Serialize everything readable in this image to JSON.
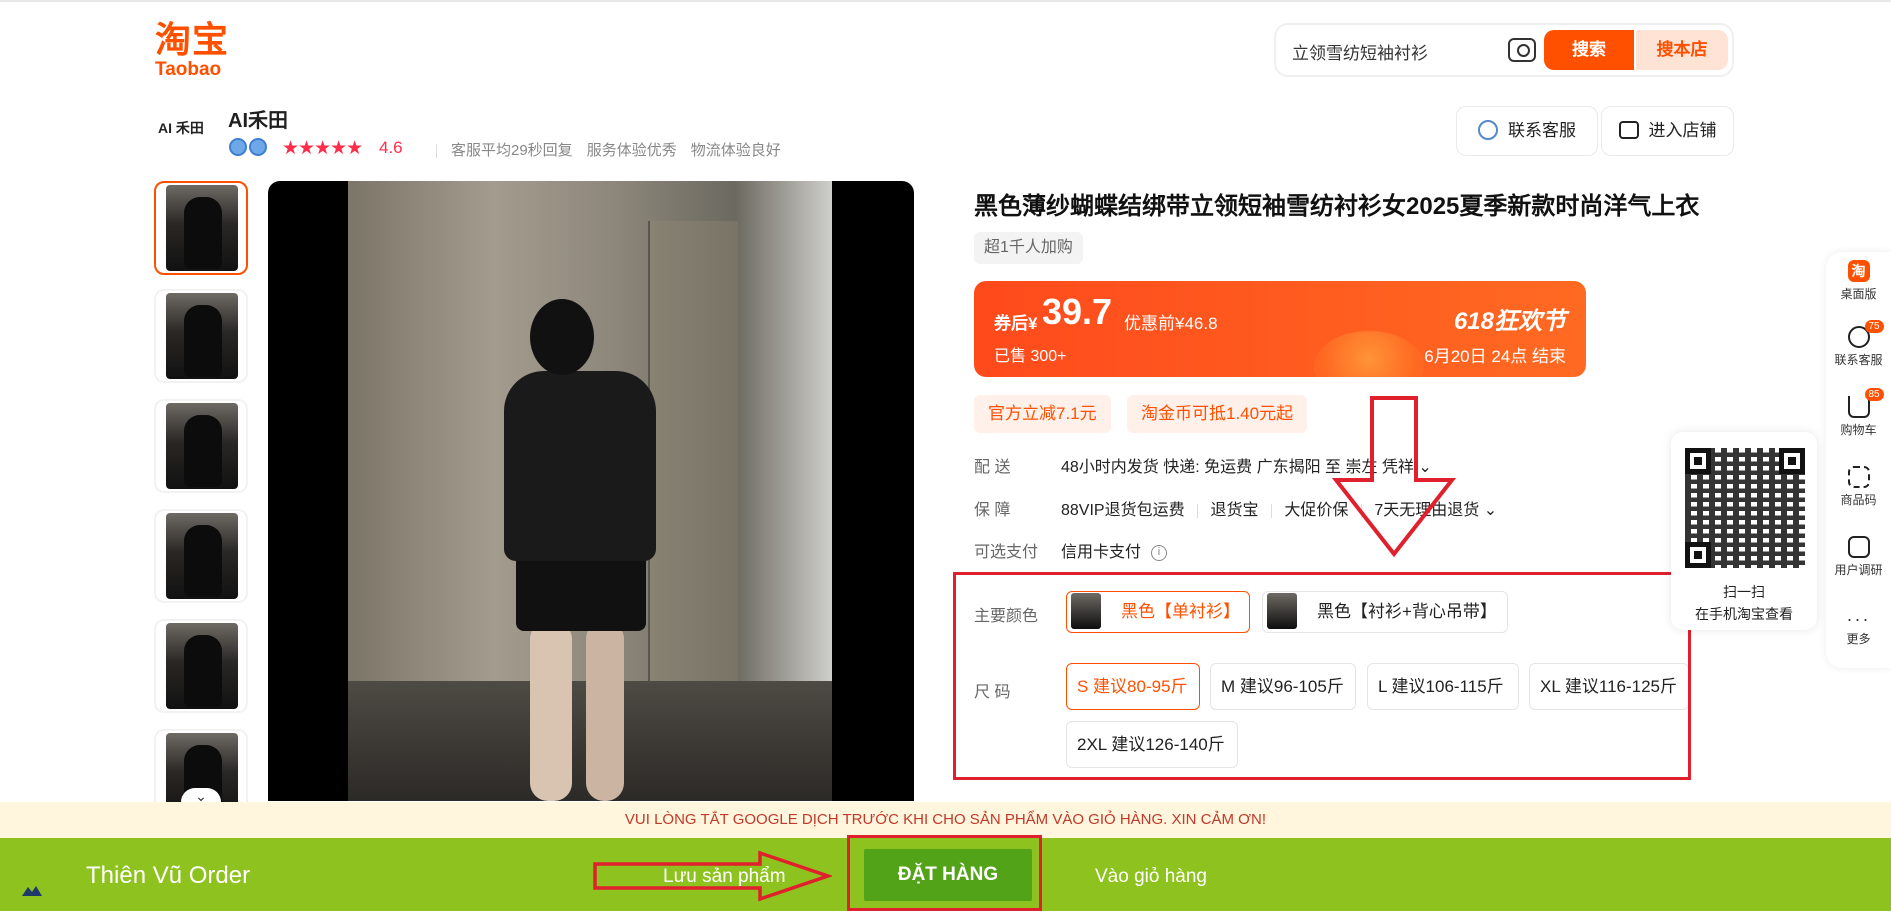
{
  "header": {
    "logo_cn": "淘宝",
    "logo_en": "Taobao",
    "search_value": "立领雪纺短袖衬衫",
    "search_button": "搜索",
    "shop_search_button": "搜本店"
  },
  "store": {
    "avatar_text": "AI 禾田",
    "name": "AI禾田",
    "stars": "★★★★★",
    "rating": "4.6",
    "service_items": [
      "客服平均29秒回复",
      "服务体验优秀",
      "物流体验良好"
    ],
    "contact_button": "联系客服",
    "enter_shop_button": "进入店铺"
  },
  "product": {
    "title": "黑色薄纱蝴蝶结绑带立领短袖雪纺衬衫女2025夏季新款时尚洋气上衣",
    "popularity_tag": "超1千人加购",
    "price": {
      "label": "券后¥",
      "value": "39.7",
      "original": "优惠前¥46.8",
      "sold": "已售 300+",
      "festival": "618狂欢节",
      "festival_end": "6月20日 24点  结束"
    },
    "coupons": [
      "官方立减7.1元",
      "淘金币可抵1.40元起"
    ],
    "delivery": {
      "label": "配    送",
      "value": "48小时内发货  快递: 免运费  广东揭阳  至  崇左 凭祥 ⌄"
    },
    "guarantee": {
      "label": "保    障",
      "items": [
        "88VIP退货包运费",
        "退货宝",
        "大促价保",
        "7天无理由退货 ⌄"
      ]
    },
    "payment": {
      "label": "可选支付",
      "value": "信用卡支付"
    },
    "color": {
      "label": "主要颜色",
      "options": [
        "黑色【单衬衫】",
        "黑色【衬衫+背心吊带】"
      ],
      "selected": 0
    },
    "size": {
      "label": "尺    码",
      "options": [
        "S 建议80-95斤",
        "M 建议96-105斤",
        "L 建议106-115斤",
        "XL 建议116-125斤",
        "2XL 建议126-140斤"
      ],
      "selected": 0
    }
  },
  "sidebar": {
    "items": [
      {
        "label": "桌面版",
        "icon": "taobao-icon"
      },
      {
        "label": "联系客服",
        "icon": "chat-icon",
        "badge": "75"
      },
      {
        "label": "购物车",
        "icon": "cart-icon",
        "badge": "85"
      },
      {
        "label": "商品码",
        "icon": "qr-code-icon"
      },
      {
        "label": "用户调研",
        "icon": "survey-icon"
      },
      {
        "label": "更多",
        "icon": "more-icon"
      }
    ],
    "qr_line1": "扫一扫",
    "qr_line2": "在手机淘宝查看"
  },
  "order_bar": {
    "warning": "VUI LÒNG TẮT GOOGLE DỊCH TRƯỚC KHI CHO SẢN PHẨM VÀO GIỎ HÀNG. XIN CẢM ƠN!",
    "brand": "Thiên Vũ Order",
    "save_button": "Lưu sản phẩm",
    "order_button": "ĐẶT HÀNG",
    "cart_button": "Vào giỏ hàng"
  },
  "colors": {
    "accent": "#ff5000",
    "order_bar": "#8dc21f",
    "order_button": "#53a318",
    "annotation": "#e0202c"
  }
}
